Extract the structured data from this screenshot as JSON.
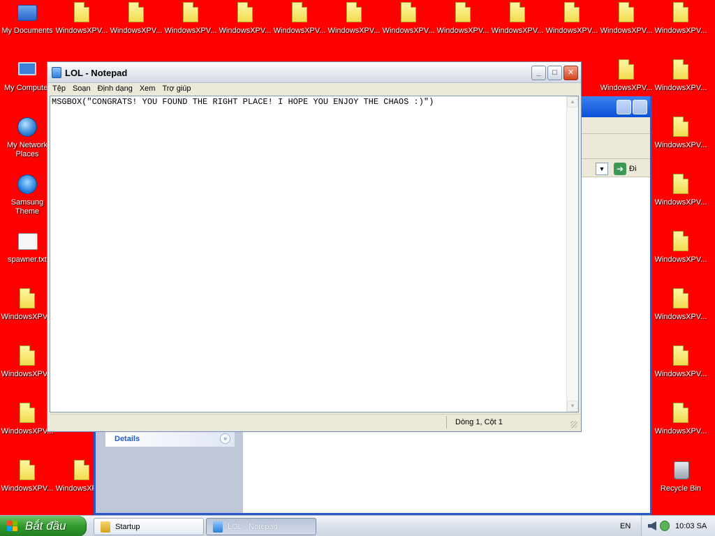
{
  "desktop": {
    "background": "#ff0000",
    "icons": [
      {
        "id": "mydocs",
        "label": "My Documents",
        "icon": "my-documents-icon",
        "kind": "folder"
      },
      {
        "id": "f1",
        "label": "WindowsXPV...",
        "icon": "file-icon",
        "kind": "file"
      },
      {
        "id": "f2",
        "label": "WindowsXPV...",
        "icon": "file-icon",
        "kind": "file"
      },
      {
        "id": "f3",
        "label": "WindowsXPV...",
        "icon": "file-icon",
        "kind": "file"
      },
      {
        "id": "f4",
        "label": "WindowsXPV...",
        "icon": "file-icon",
        "kind": "file"
      },
      {
        "id": "f5",
        "label": "WindowsXPV...",
        "icon": "file-icon",
        "kind": "file"
      },
      {
        "id": "f6",
        "label": "WindowsXPV...",
        "icon": "file-icon",
        "kind": "file"
      },
      {
        "id": "f7",
        "label": "WindowsXPV...",
        "icon": "file-icon",
        "kind": "file"
      },
      {
        "id": "f8",
        "label": "WindowsXPV...",
        "icon": "file-icon",
        "kind": "file"
      },
      {
        "id": "f9",
        "label": "WindowsXPV...",
        "icon": "file-icon",
        "kind": "file"
      },
      {
        "id": "f10",
        "label": "WindowsXPV...",
        "icon": "file-icon",
        "kind": "file"
      },
      {
        "id": "f11",
        "label": "WindowsXPV...",
        "icon": "file-icon",
        "kind": "file"
      },
      {
        "id": "f12",
        "label": "WindowsXPV...",
        "icon": "file-icon",
        "kind": "file"
      },
      {
        "id": "mycomputer",
        "label": "My Computer",
        "icon": "my-computer-icon",
        "kind": "computer"
      },
      {
        "id": "f13",
        "label": "WindowsXPV...",
        "icon": "file-icon",
        "kind": "file"
      },
      {
        "id": "f14",
        "label": "WindowsXPV...",
        "icon": "file-icon",
        "kind": "file"
      },
      {
        "id": "network",
        "label": "My Network Places",
        "icon": "network-places-icon",
        "kind": "network"
      },
      {
        "id": "f15",
        "label": "WindowsXPV...",
        "icon": "file-icon",
        "kind": "file"
      },
      {
        "id": "samsung",
        "label": "Samsung Theme",
        "icon": "samsung-theme-icon",
        "kind": "theme"
      },
      {
        "id": "f16",
        "label": "WindowsXPV...",
        "icon": "file-icon",
        "kind": "file"
      },
      {
        "id": "spawner",
        "label": "spawner.txt",
        "icon": "text-file-icon",
        "kind": "txt"
      },
      {
        "id": "f17",
        "label": "WindowsXPV...",
        "icon": "file-icon",
        "kind": "file"
      },
      {
        "id": "f18",
        "label": "WindowsXPV...",
        "icon": "file-icon",
        "kind": "file"
      },
      {
        "id": "f19",
        "label": "WindowsXPV...",
        "icon": "file-icon",
        "kind": "file"
      },
      {
        "id": "f20",
        "label": "WindowsXPV...",
        "icon": "file-icon",
        "kind": "file"
      },
      {
        "id": "f21",
        "label": "WindowsXPV...",
        "icon": "file-icon",
        "kind": "file"
      },
      {
        "id": "f22",
        "label": "WindowsXPV...",
        "icon": "file-icon",
        "kind": "file"
      },
      {
        "id": "f23",
        "label": "WindowsXPV...",
        "icon": "file-icon",
        "kind": "file"
      },
      {
        "id": "f24",
        "label": "WindowsXPV...",
        "icon": "file-icon",
        "kind": "file"
      },
      {
        "id": "f25",
        "label": "WindowsXPV...",
        "icon": "file-icon",
        "kind": "file"
      },
      {
        "id": "recycle",
        "label": "Recycle Bin",
        "icon": "recycle-bin-icon",
        "kind": "bin"
      }
    ]
  },
  "explorer": {
    "go_label": "Đi",
    "details_label": "Details"
  },
  "notepad": {
    "title": "LOL - Notepad",
    "menu": [
      "Tệp",
      "Soạn",
      "Định dạng",
      "Xem",
      "Trợ giúp"
    ],
    "content": "MSGBOX(\"CONGRATS! YOU FOUND THE RIGHT PLACE! I HOPE YOU ENJOY THE CHAOS :)\")",
    "status_position": "Dòng 1, Cột 1"
  },
  "taskbar": {
    "start_label": "Bắt đầu",
    "tasks": [
      {
        "label": "Startup",
        "active": false
      },
      {
        "label": "LOL - Notepad",
        "active": true
      }
    ],
    "language": "EN",
    "clock": "10:03 SA"
  }
}
